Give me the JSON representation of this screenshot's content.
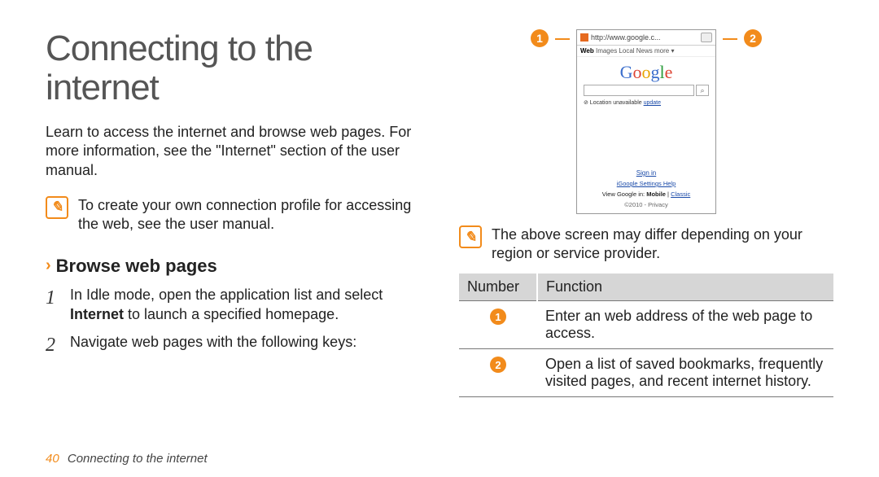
{
  "page": {
    "title_line1": "Connecting to the",
    "title_line2": "internet",
    "intro": "Learn to access the internet and browse web pages. For more information, see the \"Internet\" section of the user manual.",
    "footer_page": "40",
    "footer_title": "Connecting to the internet"
  },
  "note1": {
    "text": "To create your own connection profile for accessing the web, see the user manual."
  },
  "section": {
    "title": "Browse web pages",
    "steps": [
      {
        "num": "1",
        "before": "In Idle mode, open the application list and select ",
        "bold": "Internet",
        "after": " to launch a specified homepage."
      },
      {
        "num": "2",
        "before": "Navigate web pages with the following keys:",
        "bold": "",
        "after": ""
      }
    ]
  },
  "callouts": {
    "left": "1",
    "right": "2"
  },
  "phone": {
    "url": "http://www.google.c...",
    "tabs_bold": "Web",
    "tabs_rest": " Images Local News more ▾",
    "logo": {
      "l1": "G",
      "l2": "o",
      "l3": "o",
      "l4": "g",
      "l5": "l",
      "l6": "e"
    },
    "loc_prefix": "⊘ Location unavailable ",
    "loc_link": "update",
    "signin": "Sign in",
    "footer_links": "iGoogle  Settings  Help",
    "view_prefix": "View Google in: ",
    "view_bold": "Mobile",
    "view_sep": " | ",
    "view_link": "Classic",
    "copyright": "©2010 - Privacy"
  },
  "note2": {
    "text": "The above screen may differ depending on your region or service provider."
  },
  "table": {
    "head_number": "Number",
    "head_function": "Function",
    "rows": [
      {
        "num": "1",
        "func": "Enter an web address of the web page to access."
      },
      {
        "num": "2",
        "func": "Open a list of saved bookmarks, frequently visited pages, and recent internet history."
      }
    ]
  }
}
